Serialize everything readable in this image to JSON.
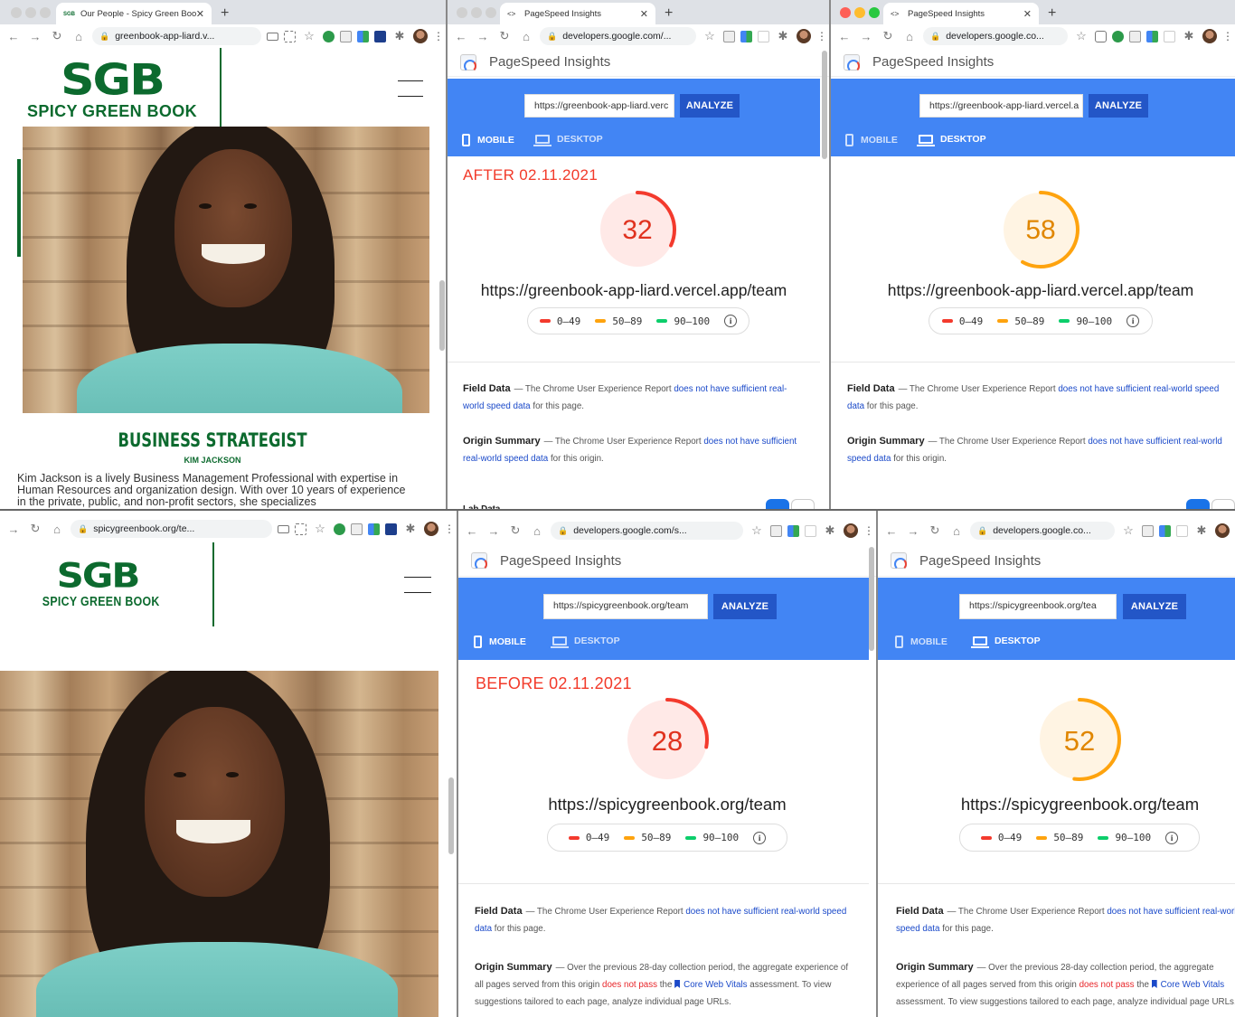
{
  "tl": {
    "tab_title": "Our People - Spicy Green Book",
    "url": "greenbook-app-liard.v...",
    "logo_big": "SGB",
    "logo_sub": "SPICY GREEN BOOK",
    "role": "BUSINESS STRATEGIST",
    "name": "KIM JACKSON",
    "bio": "Kim Jackson is a lively Business Management Professional with expertise in Human Resources and organization design. With over 10 years of experience in the private, public, and non-profit sectors, she specializes"
  },
  "tm": {
    "tab_title": "PageSpeed Insights",
    "url": "developers.google.com/...",
    "app_title": "PageSpeed Insights",
    "input_value": "https://greenbook-app-liard.verc",
    "analyze_label": "ANALYZE",
    "mobile_label": "MOBILE",
    "desktop_label": "DESKTOP",
    "note": "AFTER 02.11.2021",
    "score": "32",
    "score_value": 32,
    "page_url": "https://greenbook-app-liard.vercel.app/team",
    "field_title": "Field Data",
    "field_pre": "— The Chrome User Experience Report ",
    "field_link": "does not have sufficient real-world speed data",
    "field_post": " for this page.",
    "origin_title": "Origin Summary",
    "origin_pre": "— The Chrome User Experience Report ",
    "origin_link": "does not have sufficient real-world speed data",
    "origin_post": " for this origin.",
    "lab_peek": "Lab Data"
  },
  "tr": {
    "tab_title": "PageSpeed Insights",
    "url": "developers.google.co...",
    "app_title": "PageSpeed Insights",
    "input_value": "https://greenbook-app-liard.vercel.a",
    "analyze_label": "ANALYZE",
    "mobile_label": "MOBILE",
    "desktop_label": "DESKTOP",
    "score": "58",
    "score_value": 58,
    "page_url": "https://greenbook-app-liard.vercel.app/team",
    "field_title": "Field Data",
    "field_pre": "— The Chrome User Experience Report ",
    "field_link": "does not have sufficient real-world speed data",
    "field_post": " for this page.",
    "origin_title": "Origin Summary",
    "origin_pre": "— The Chrome User Experience Report ",
    "origin_link": "does not have sufficient real-world speed data",
    "origin_post": " for this origin."
  },
  "bl": {
    "url": "spicygreenbook.org/te...",
    "logo_big": "SGB",
    "logo_sub": "SPICY GREEN BOOK"
  },
  "bm": {
    "url": "developers.google.com/s...",
    "app_title": "PageSpeed Insights",
    "input_value": "https://spicygreenbook.org/team",
    "analyze_label": "ANALYZE",
    "mobile_label": "MOBILE",
    "desktop_label": "DESKTOP",
    "note": "BEFORE 02.11.2021",
    "score": "28",
    "score_value": 28,
    "page_url": "https://spicygreenbook.org/team",
    "field_title": "Field Data",
    "field_pre": "— The Chrome User Experience Report ",
    "field_link": "does not have sufficient real-world speed data",
    "field_post": " for this page.",
    "origin_title": "Origin Summary",
    "origin_pre": "— Over the previous 28-day collection period, the aggregate experience of all pages served from this origin ",
    "origin_bad": "does not pass",
    "origin_mid": " the ",
    "origin_cwv": "Core Web Vitals",
    "origin_post": " assessment. To view suggestions tailored to each page, analyze individual page URLs."
  },
  "br": {
    "url": "developers.google.co...",
    "app_title": "PageSpeed Insights",
    "input_value": "https://spicygreenbook.org/tea",
    "analyze_label": "ANALYZE",
    "mobile_label": "MOBILE",
    "desktop_label": "DESKTOP",
    "score": "52",
    "score_value": 52,
    "page_url": "https://spicygreenbook.org/team",
    "field_title": "Field Data",
    "field_pre": "— The Chrome User Experience Report ",
    "field_link": "does not have sufficient real-world speed data",
    "field_post": " for this page.",
    "origin_title": "Origin Summary",
    "origin_pre": "— Over the previous 28-day collection period, the aggregate experience of all pages served from this origin ",
    "origin_bad": "does not pass",
    "origin_mid": " the ",
    "origin_cwv": "Core Web Vitals",
    "origin_post": " assessment. To view suggestions tailored to each page, analyze individual page URLs."
  },
  "legend": {
    "poor": "0–49",
    "average": "50–89",
    "good": "90–100",
    "info": "i"
  },
  "colors": {
    "poor": "#f33a2d",
    "average": "#fea30e",
    "good": "#0cce6b",
    "psi_blue": "#4285f4",
    "sgb_green": "#0c6a2e"
  }
}
